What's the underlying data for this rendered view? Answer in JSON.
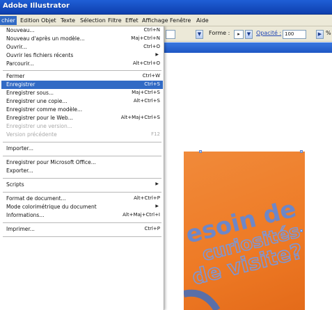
{
  "window": {
    "title": "Adobe Illustrator"
  },
  "menubar": {
    "items": [
      {
        "label": "chier",
        "active": true
      },
      {
        "label": "Edition"
      },
      {
        "label": "Objet"
      },
      {
        "label": "Texte"
      },
      {
        "label": "Sélection"
      },
      {
        "label": "Filtre"
      },
      {
        "label": "Effet"
      },
      {
        "label": "Affichage"
      },
      {
        "label": "Fenêtre"
      },
      {
        "label": "Aide"
      }
    ]
  },
  "toolbar": {
    "forme_label": "Forme :",
    "opacity_label": "Opacité :",
    "opacity_value": "100",
    "trailing_label": "%"
  },
  "file_menu": {
    "items": [
      {
        "label": "Nouveau...",
        "shortcut": "Ctrl+N"
      },
      {
        "label": "Nouveau d'après un modèle...",
        "shortcut": "Maj+Ctrl+N"
      },
      {
        "label": "Ouvrir...",
        "shortcut": "Ctrl+O"
      },
      {
        "label": "Ouvrir les fichiers récents",
        "shortcut": "",
        "submenu": true
      },
      {
        "label": "Parcourir...",
        "shortcut": "Alt+Ctrl+O"
      },
      {
        "label": "Fermer",
        "shortcut": "Ctrl+W"
      },
      {
        "label": "Enregistrer",
        "shortcut": "Ctrl+S",
        "highlighted": true
      },
      {
        "label": "Enregistrer sous...",
        "shortcut": "Maj+Ctrl+S"
      },
      {
        "label": "Enregistrer une copie...",
        "shortcut": "Alt+Ctrl+S"
      },
      {
        "label": "Enregistrer comme modèle...",
        "shortcut": ""
      },
      {
        "label": "Enregistrer pour le Web...",
        "shortcut": "Alt+Maj+Ctrl+S"
      },
      {
        "label": "Enregistrer une version...",
        "shortcut": "",
        "disabled": true
      },
      {
        "label": "Version précédente",
        "shortcut": "F12",
        "disabled": true
      },
      {
        "label": "Importer...",
        "shortcut": ""
      },
      {
        "label": "Enregistrer pour Microsoft Office...",
        "shortcut": ""
      },
      {
        "label": "Exporter...",
        "shortcut": ""
      },
      {
        "label": "Scripts",
        "shortcut": "",
        "submenu": true
      },
      {
        "label": "Format de document...",
        "shortcut": "Alt+Ctrl+P"
      },
      {
        "label": "Mode colorimétrique du document",
        "shortcut": "",
        "submenu": true
      },
      {
        "label": "Informations...",
        "shortcut": "Alt+Maj+Ctrl+I"
      },
      {
        "label": "Imprimer...",
        "shortcut": "Ctrl+P"
      }
    ]
  },
  "artwork": {
    "line1": "esoin de",
    "line2": "curiosités",
    "line3": "de visite?"
  },
  "colors": {
    "titlebar": "#1f5fd6",
    "menu_highlight": "#316ac5",
    "artboard": "#ee7a25"
  }
}
